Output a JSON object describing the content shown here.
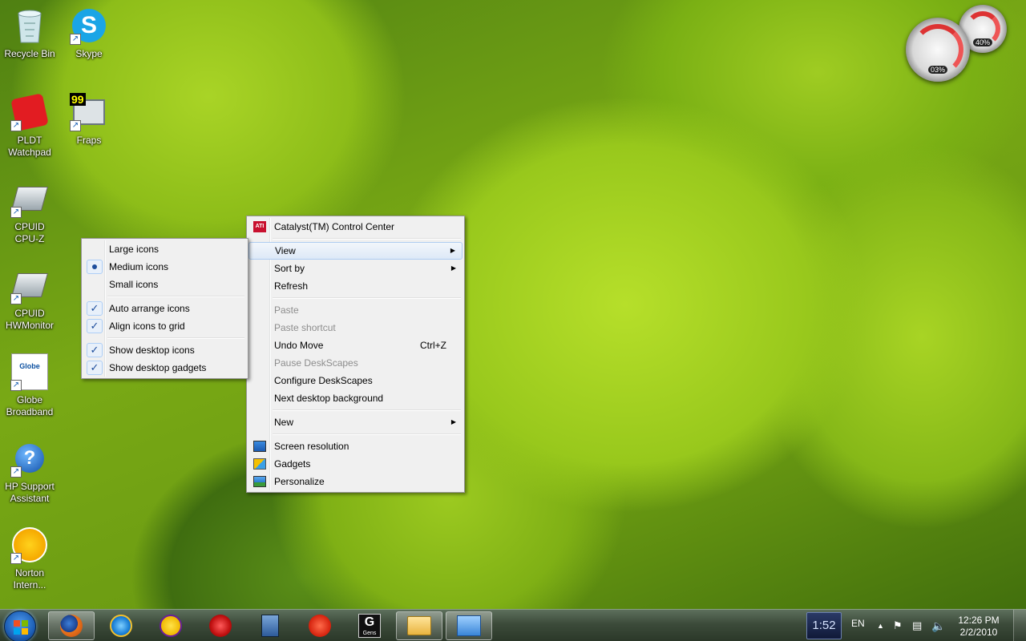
{
  "desktop_icons": [
    {
      "label": "Recycle Bin",
      "icon": "recycle-bin-icon",
      "shortcut": false
    },
    {
      "label": "Skype",
      "icon": "skype-icon",
      "shortcut": true
    },
    {
      "label": "PLDT\nWatchpad",
      "icon": "pldt-watchpad-icon",
      "shortcut": true
    },
    {
      "label": "Fraps",
      "icon": "fraps-icon",
      "shortcut": true,
      "badge": "99"
    },
    {
      "label": "CPUID\nCPU-Z",
      "icon": "cpuz-icon",
      "shortcut": true
    },
    {
      "label": "CPUID\nHWMonitor",
      "icon": "hwmonitor-icon",
      "shortcut": true
    },
    {
      "label": "Globe\nBroadband",
      "icon": "globe-broadband-icon",
      "shortcut": true,
      "badge": "Globe"
    },
    {
      "label": "HP Support\nAssistant",
      "icon": "hp-support-icon",
      "shortcut": true
    },
    {
      "label": "Norton\nIntern...",
      "icon": "norton-icon",
      "shortcut": true
    }
  ],
  "gadget": {
    "cpu_value": "03%",
    "memory_value": "40%"
  },
  "context_menu": {
    "items": [
      {
        "label": "Catalyst(TM) Control Center",
        "icon": "ati-icon"
      },
      {
        "label": "View",
        "submenu": true,
        "highlighted": true
      },
      {
        "label": "Sort by",
        "submenu": true
      },
      {
        "label": "Refresh"
      },
      {
        "label": "Paste",
        "disabled": true
      },
      {
        "label": "Paste shortcut",
        "disabled": true
      },
      {
        "label": "Undo Move",
        "shortcut": "Ctrl+Z"
      },
      {
        "label": "Pause DeskScapes",
        "disabled": true
      },
      {
        "label": "Configure DeskScapes"
      },
      {
        "label": "Next desktop background"
      },
      {
        "label": "New",
        "submenu": true
      },
      {
        "label": "Screen resolution",
        "icon": "screen-resolution-icon"
      },
      {
        "label": "Gadgets",
        "icon": "gadgets-icon"
      },
      {
        "label": "Personalize",
        "icon": "personalize-icon"
      }
    ]
  },
  "view_submenu": {
    "items": [
      {
        "label": "Large icons"
      },
      {
        "label": "Medium icons",
        "state": "bullet"
      },
      {
        "label": "Small icons"
      },
      {
        "label": "Auto arrange icons",
        "state": "check"
      },
      {
        "label": "Align icons to grid",
        "state": "check"
      },
      {
        "label": "Show desktop icons",
        "state": "check"
      },
      {
        "label": "Show desktop gadgets",
        "state": "check"
      }
    ]
  },
  "taskbar": {
    "buttons": [
      {
        "name": "firefox",
        "icon": "firefox-icon",
        "active": true
      },
      {
        "name": "internet-explorer",
        "icon": "ie-icon"
      },
      {
        "name": "yahoo-messenger",
        "icon": "yahoo-messenger-icon"
      },
      {
        "name": "debian-app",
        "icon": "swirl-icon"
      },
      {
        "name": "file-tool",
        "icon": "file-door-icon"
      },
      {
        "name": "red-app",
        "icon": "red-logo-icon"
      },
      {
        "name": "gens",
        "icon": "gens-icon",
        "label": "Gens"
      },
      {
        "name": "windows-explorer",
        "icon": "folder-icon",
        "active": true
      },
      {
        "name": "control-panel",
        "icon": "control-panel-icon",
        "active": true
      }
    ],
    "clock_gadget": "1:52",
    "language": "EN",
    "time": "12:26 PM",
    "date": "2/2/2010"
  }
}
